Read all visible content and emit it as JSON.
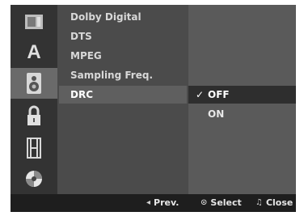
{
  "menu": {
    "items": [
      {
        "label": "Dolby Digital"
      },
      {
        "label": "DTS"
      },
      {
        "label": "MPEG"
      },
      {
        "label": "Sampling Freq."
      },
      {
        "label": "DRC"
      }
    ],
    "selected_index": 4
  },
  "sidebar": {
    "icons": [
      {
        "name": "disc-settings-icon"
      },
      {
        "name": "language-icon",
        "glyph": "A"
      },
      {
        "name": "audio-speaker-icon"
      },
      {
        "name": "lock-icon"
      },
      {
        "name": "film-icon"
      },
      {
        "name": "disc-icon"
      }
    ],
    "active_index": 2
  },
  "options": {
    "items": [
      {
        "label": "OFF",
        "checked": true
      },
      {
        "label": "ON",
        "checked": false
      }
    ],
    "check_glyph": "✓"
  },
  "footer": {
    "prev": {
      "icon": "◂",
      "label": "Prev."
    },
    "select": {
      "icon": "⊙",
      "label": "Select"
    },
    "close": {
      "icon": "♫",
      "label": "Close"
    }
  },
  "colors": {
    "panel": "#4b4b4b",
    "sidebar": "#333333",
    "highlight": "#5f5f5f",
    "options_bg": "#5a5a5a",
    "option_selected": "#2e2e2e",
    "footer": "#1e1e1e"
  }
}
